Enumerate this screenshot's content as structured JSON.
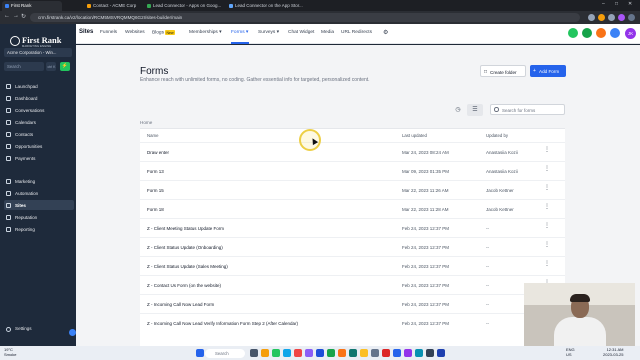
{
  "browser": {
    "tabs": [
      {
        "label": "First Rank",
        "active": true
      },
      {
        "label": "Contact - ACME Corp",
        "active": false
      },
      {
        "label": "Lead Connector - Apps on Goog...",
        "active": false
      },
      {
        "label": "Lead Connector on the App Stor...",
        "active": false
      }
    ],
    "url": "crm.firstrank.ca/v2/location/RCM5MSVRQMMQ6G2I/sites-builder/main",
    "window_controls": [
      "–",
      "□",
      "✕"
    ]
  },
  "sidebar": {
    "brand": {
      "name": "First Rank",
      "tagline": "MARKETING ENGINE"
    },
    "account": "Acme Corporation - Win...",
    "search_placeholder": "Search",
    "search_shortcut": "ctrl K",
    "items": [
      {
        "label": "Launchpad",
        "icon": "rocket-icon",
        "active": false
      },
      {
        "label": "Dashboard",
        "icon": "dashboard-icon",
        "active": false
      },
      {
        "label": "Conversations",
        "icon": "chat-icon",
        "active": false
      },
      {
        "label": "Calendars",
        "icon": "calendar-icon",
        "active": false
      },
      {
        "label": "Contacts",
        "icon": "contacts-icon",
        "active": false
      },
      {
        "label": "Opportunities",
        "icon": "funnel-icon",
        "active": false
      },
      {
        "label": "Payments",
        "icon": "payments-icon",
        "active": false
      },
      {
        "label": "Marketing",
        "icon": "megaphone-icon",
        "active": false
      },
      {
        "label": "Automation",
        "icon": "automation-icon",
        "active": false
      },
      {
        "label": "Sites",
        "icon": "globe-icon",
        "active": true
      },
      {
        "label": "Reputation",
        "icon": "star-icon",
        "active": false
      },
      {
        "label": "Reporting",
        "icon": "chart-icon",
        "active": false
      }
    ],
    "settings_label": "Settings"
  },
  "topnav": {
    "section": "Sites",
    "tabs": [
      {
        "label": "Funnels",
        "active": false
      },
      {
        "label": "Websites",
        "active": false
      },
      {
        "label": "Blogs",
        "badge": "New",
        "active": false
      },
      {
        "label": "Memberships ▾",
        "active": false
      },
      {
        "label": "Forms ▾",
        "active": true
      },
      {
        "label": "Surveys ▾",
        "active": false
      },
      {
        "label": "Chat Widget",
        "active": false
      },
      {
        "label": "Media",
        "active": false
      },
      {
        "label": "URL Redirects",
        "active": false
      }
    ],
    "avatar_initials": "JK",
    "colors": {
      "phone": "#22c55e",
      "chat": "#16a34a",
      "bell": "#f97316",
      "help": "#3b82f6",
      "avatar": "#9333ea"
    }
  },
  "page": {
    "title": "Forms",
    "description": "Enhance reach with unlimited forms, no coding. Gather essential info for targeted, personalized content.",
    "create_folder_label": "Create folder",
    "add_form_label": "Add Form",
    "search_placeholder": "Search for forms",
    "breadcrumb": "Home",
    "columns": [
      "Name",
      "Last updated",
      "Updated by"
    ],
    "rows": [
      {
        "name": "Draw enter",
        "updated": "Mar 24, 2023 08:24 AM",
        "by": "Anastasiia Kozii"
      },
      {
        "name": "Form 13",
        "updated": "Mar 09, 2023 01:35 PM",
        "by": "Anastasiia Kozii"
      },
      {
        "name": "Form 15",
        "updated": "Mar 22, 2023 11:26 AM",
        "by": "Jacob Kettner"
      },
      {
        "name": "Form 18",
        "updated": "Mar 22, 2023 11:28 AM",
        "by": "Jacob Kettner"
      },
      {
        "name": "Z - Client Meeting Status Update Form",
        "updated": "Feb 24, 2023 12:37 PM",
        "by": "--"
      },
      {
        "name": "Z - Client Status Update (Onboarding)",
        "updated": "Feb 24, 2023 12:37 PM",
        "by": "--"
      },
      {
        "name": "Z - Client Status Update (Sales Meeting)",
        "updated": "Feb 24, 2023 12:37 PM",
        "by": "--"
      },
      {
        "name": "Z - Contact Us Form (on the website)",
        "updated": "Feb 24, 2023 12:37 PM",
        "by": "--"
      },
      {
        "name": "Z - Incoming Call Now Lead Form",
        "updated": "Feb 24, 2023 12:37 PM",
        "by": "--"
      },
      {
        "name": "Z - Incoming Call Now Lead Verify Information Form Step 2 (After Calendar)",
        "updated": "Feb 24, 2023 12:37 PM",
        "by": "--"
      }
    ]
  },
  "taskbar": {
    "weather_temp": "19°C",
    "weather_desc": "Smoke",
    "search_placeholder": "Search",
    "tray_lang": "ENG",
    "tray_region": "US",
    "time": "12:31 AM",
    "date": "2023-03-25"
  }
}
